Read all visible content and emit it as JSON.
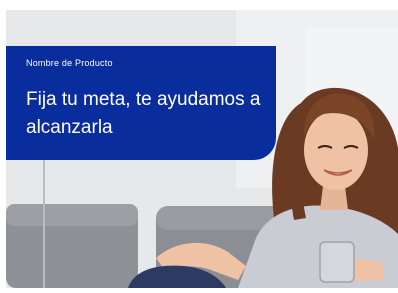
{
  "banner": {
    "product_name": "Nombre de Producto",
    "headline": "Fija tu meta, te ayudamos a alcanzarla"
  },
  "hero_image": {
    "description_icon": "woman-on-sofa-with-phone-photo"
  },
  "colors": {
    "banner_background": "#0a2d9e",
    "banner_text": "#ffffff",
    "page_background": "#ffffff"
  }
}
